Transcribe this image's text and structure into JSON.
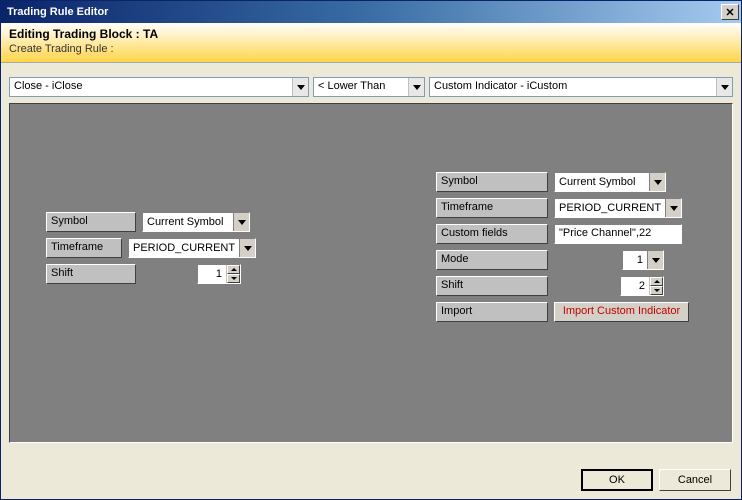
{
  "window": {
    "title": "Trading Rule Editor"
  },
  "header": {
    "line1": "Editing Trading Block : TA",
    "line2": "Create Trading Rule :"
  },
  "selectors": {
    "left": "Close - iClose",
    "middle": "< Lower Than",
    "right": "Custom Indicator - iCustom"
  },
  "leftPanel": {
    "symbol_label": "Symbol",
    "symbol_value": "Current Symbol",
    "timeframe_label": "Timeframe",
    "timeframe_value": "PERIOD_CURRENT",
    "shift_label": "Shift",
    "shift_value": "1"
  },
  "rightPanel": {
    "symbol_label": "Symbol",
    "symbol_value": "Current Symbol",
    "timeframe_label": "Timeframe",
    "timeframe_value": "PERIOD_CURRENT",
    "custom_label": "Custom fields",
    "custom_value": "\"Price Channel\",22",
    "mode_label": "Mode",
    "mode_value": "1",
    "shift_label": "Shift",
    "shift_value": "2",
    "import_label": "Import",
    "import_button": "Import Custom Indicator"
  },
  "buttons": {
    "ok": "OK",
    "cancel": "Cancel"
  }
}
